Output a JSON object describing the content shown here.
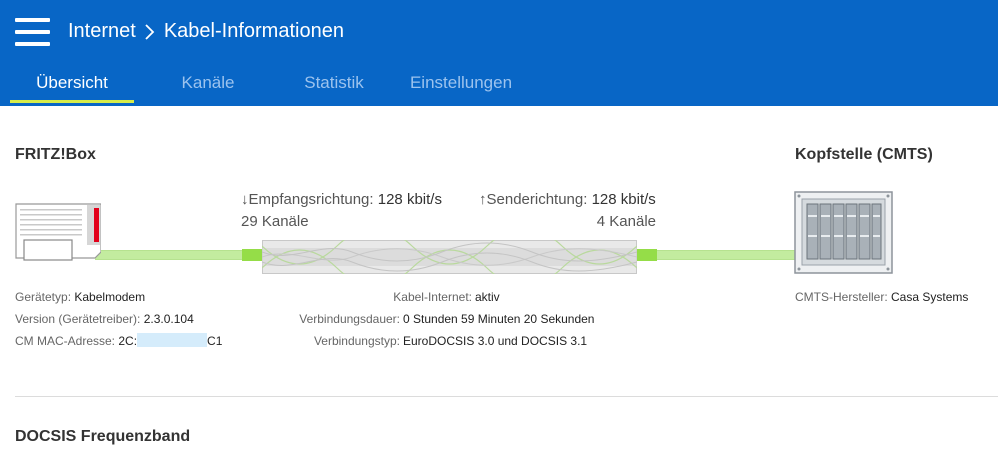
{
  "header": {
    "breadcrumb": {
      "root": "Internet",
      "page": "Kabel-Informationen"
    },
    "tabs": [
      {
        "label": "Übersicht",
        "active": true
      },
      {
        "label": "Kanäle",
        "active": false
      },
      {
        "label": "Statistik",
        "active": false
      },
      {
        "label": "Einstellungen",
        "active": false
      }
    ]
  },
  "overview": {
    "left_title": "FRITZ!Box",
    "right_title": "Kopfstelle (CMTS)",
    "downstream": {
      "label": "Empfangsrichtung:",
      "rate": "128 kbit/s",
      "channels": "29 Kanäle"
    },
    "upstream": {
      "label": "Senderichtung:",
      "rate": "128 kbit/s",
      "channels": "4 Kanäle"
    },
    "device_info": {
      "type_label": "Gerätetyp:",
      "type_value": "Kabelmodem",
      "version_label": "Version (Gerätetreiber):",
      "version_value": "2.3.0.104",
      "mac_label": "CM MAC-Adresse:",
      "mac_prefix": "2C:",
      "mac_suffix": "C1"
    },
    "connection_info": {
      "internet_label": "Kabel-Internet:",
      "internet_value": "aktiv",
      "duration_label": "Verbindungsdauer:",
      "duration_value": "0 Stunden 59 Minuten 20 Sekunden",
      "type_label": "Verbindungstyp:",
      "type_value": "EuroDOCSIS 3.0 und DOCSIS 3.1"
    },
    "cmts_info": {
      "vendor_label": "CMTS-Hersteller:",
      "vendor_value": "Casa Systems"
    }
  },
  "docsis_section": {
    "title": "DOCSIS Frequenzband"
  },
  "colors": {
    "header_bg": "#0866c6",
    "tab_active_underline": "#d7ec4a",
    "cable_green": "#95dd48"
  },
  "icons": {
    "menu": "hamburger-icon",
    "separator": "chevron-right-icon",
    "arrow_down": "arrow-down-icon",
    "arrow_up": "arrow-up-icon"
  }
}
